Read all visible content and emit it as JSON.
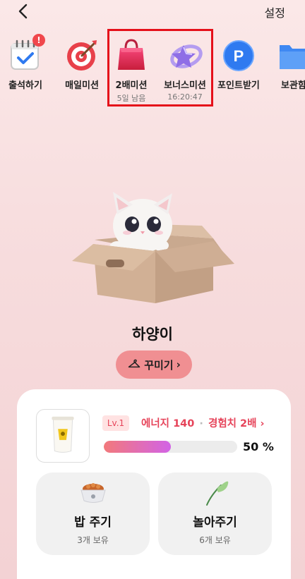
{
  "header": {
    "back_icon": "chevron-left-icon",
    "settings_label": "설정"
  },
  "menu": [
    {
      "label": "출석하기",
      "sub": "",
      "icon": "calendar-check-icon",
      "badge": "!"
    },
    {
      "label": "매일미션",
      "sub": "",
      "icon": "target-icon"
    },
    {
      "label": "2배미션",
      "sub": "5일 남음",
      "icon": "shopping-bag-icon"
    },
    {
      "label": "보너스미션",
      "sub": "16:20:47",
      "icon": "star-orbit-icon"
    },
    {
      "label": "포인트받기",
      "sub": "",
      "icon": "point-coin-icon"
    },
    {
      "label": "보관함",
      "sub": "",
      "icon": "folder-icon"
    }
  ],
  "pet": {
    "name": "하양이",
    "decorate_label": "꾸미기",
    "decorate_arrow": "›"
  },
  "status": {
    "level": "Lv.1",
    "energy_label": "에너지 140",
    "separator": "·",
    "exp_label": "경험치 2배",
    "exp_arrow": "›",
    "progress_fraction": 0.5,
    "percent_text": "50 %"
  },
  "actions": [
    {
      "title": "밥 주기",
      "sub": "3개 보유",
      "icon": "food-bowl-icon"
    },
    {
      "title": "놀아주기",
      "sub": "6개 보유",
      "icon": "feather-toy-icon"
    }
  ],
  "colors": {
    "accent": "#e6445a",
    "highlight_border": "#e5101a",
    "button_pink": "#f08f92"
  }
}
